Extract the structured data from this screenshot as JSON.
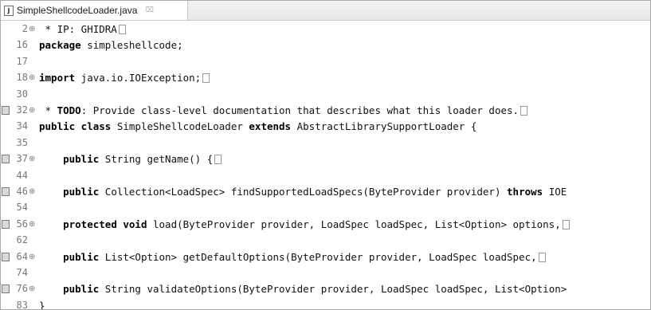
{
  "tab": {
    "file_name": "SimpleShellcodeLoader.java",
    "icon_letter": "J",
    "close_glyph": "⌧"
  },
  "lines": [
    {
      "num": "2",
      "fold": "⊕",
      "marker": false,
      "parts": [
        {
          "t": " * IP: GHIDRA",
          "b": false
        }
      ],
      "folded": true
    },
    {
      "num": "16",
      "fold": "",
      "marker": false,
      "parts": [
        {
          "t": "package",
          "b": true
        },
        {
          "t": " simpleshellcode;",
          "b": false
        }
      ],
      "folded": false
    },
    {
      "num": "17",
      "fold": "",
      "marker": false,
      "parts": [],
      "folded": false
    },
    {
      "num": "18",
      "fold": "⊕",
      "marker": false,
      "parts": [
        {
          "t": "import",
          "b": true
        },
        {
          "t": " java.io.IOException;",
          "b": false
        }
      ],
      "folded": true
    },
    {
      "num": "30",
      "fold": "",
      "marker": false,
      "parts": [],
      "folded": false
    },
    {
      "num": "32",
      "fold": "⊕",
      "marker": true,
      "parts": [
        {
          "t": " * ",
          "b": false
        },
        {
          "t": "TODO",
          "b": true
        },
        {
          "t": ": Provide class-level documentation that describes what this loader does.",
          "b": false
        }
      ],
      "folded": true
    },
    {
      "num": "34",
      "fold": "",
      "marker": false,
      "parts": [
        {
          "t": "public class",
          "b": true
        },
        {
          "t": " SimpleShellcodeLoader ",
          "b": false
        },
        {
          "t": "extends",
          "b": true
        },
        {
          "t": " AbstractLibrarySupportLoader {",
          "b": false
        }
      ],
      "folded": false
    },
    {
      "num": "35",
      "fold": "",
      "marker": false,
      "parts": [],
      "folded": false
    },
    {
      "num": "37",
      "fold": "⊕",
      "marker": true,
      "parts": [
        {
          "t": "    ",
          "b": false
        },
        {
          "t": "public",
          "b": true
        },
        {
          "t": " String getName() {",
          "b": false
        }
      ],
      "folded": true
    },
    {
      "num": "44",
      "fold": "",
      "marker": false,
      "parts": [],
      "folded": false
    },
    {
      "num": "46",
      "fold": "⊕",
      "marker": true,
      "parts": [
        {
          "t": "    ",
          "b": false
        },
        {
          "t": "public",
          "b": true
        },
        {
          "t": " Collection<LoadSpec> findSupportedLoadSpecs(ByteProvider provider) ",
          "b": false
        },
        {
          "t": "throws",
          "b": true
        },
        {
          "t": " IOE",
          "b": false
        }
      ],
      "folded": false
    },
    {
      "num": "54",
      "fold": "",
      "marker": false,
      "parts": [],
      "folded": false
    },
    {
      "num": "56",
      "fold": "⊕",
      "marker": true,
      "parts": [
        {
          "t": "    ",
          "b": false
        },
        {
          "t": "protected void",
          "b": true
        },
        {
          "t": " load(ByteProvider provider, LoadSpec loadSpec, List<Option> options,",
          "b": false
        }
      ],
      "folded": true
    },
    {
      "num": "62",
      "fold": "",
      "marker": false,
      "parts": [],
      "folded": false
    },
    {
      "num": "64",
      "fold": "⊕",
      "marker": true,
      "parts": [
        {
          "t": "    ",
          "b": false
        },
        {
          "t": "public",
          "b": true
        },
        {
          "t": " List<Option> getDefaultOptions(ByteProvider provider, LoadSpec loadSpec,",
          "b": false
        }
      ],
      "folded": true
    },
    {
      "num": "74",
      "fold": "",
      "marker": false,
      "parts": [],
      "folded": false
    },
    {
      "num": "76",
      "fold": "⊕",
      "marker": true,
      "parts": [
        {
          "t": "    ",
          "b": false
        },
        {
          "t": "public",
          "b": true
        },
        {
          "t": " String validateOptions(ByteProvider provider, LoadSpec loadSpec, List<Option>",
          "b": false
        }
      ],
      "folded": false
    },
    {
      "num": "83",
      "fold": "",
      "marker": false,
      "parts": [
        {
          "t": "}",
          "b": false
        }
      ],
      "folded": false
    }
  ]
}
